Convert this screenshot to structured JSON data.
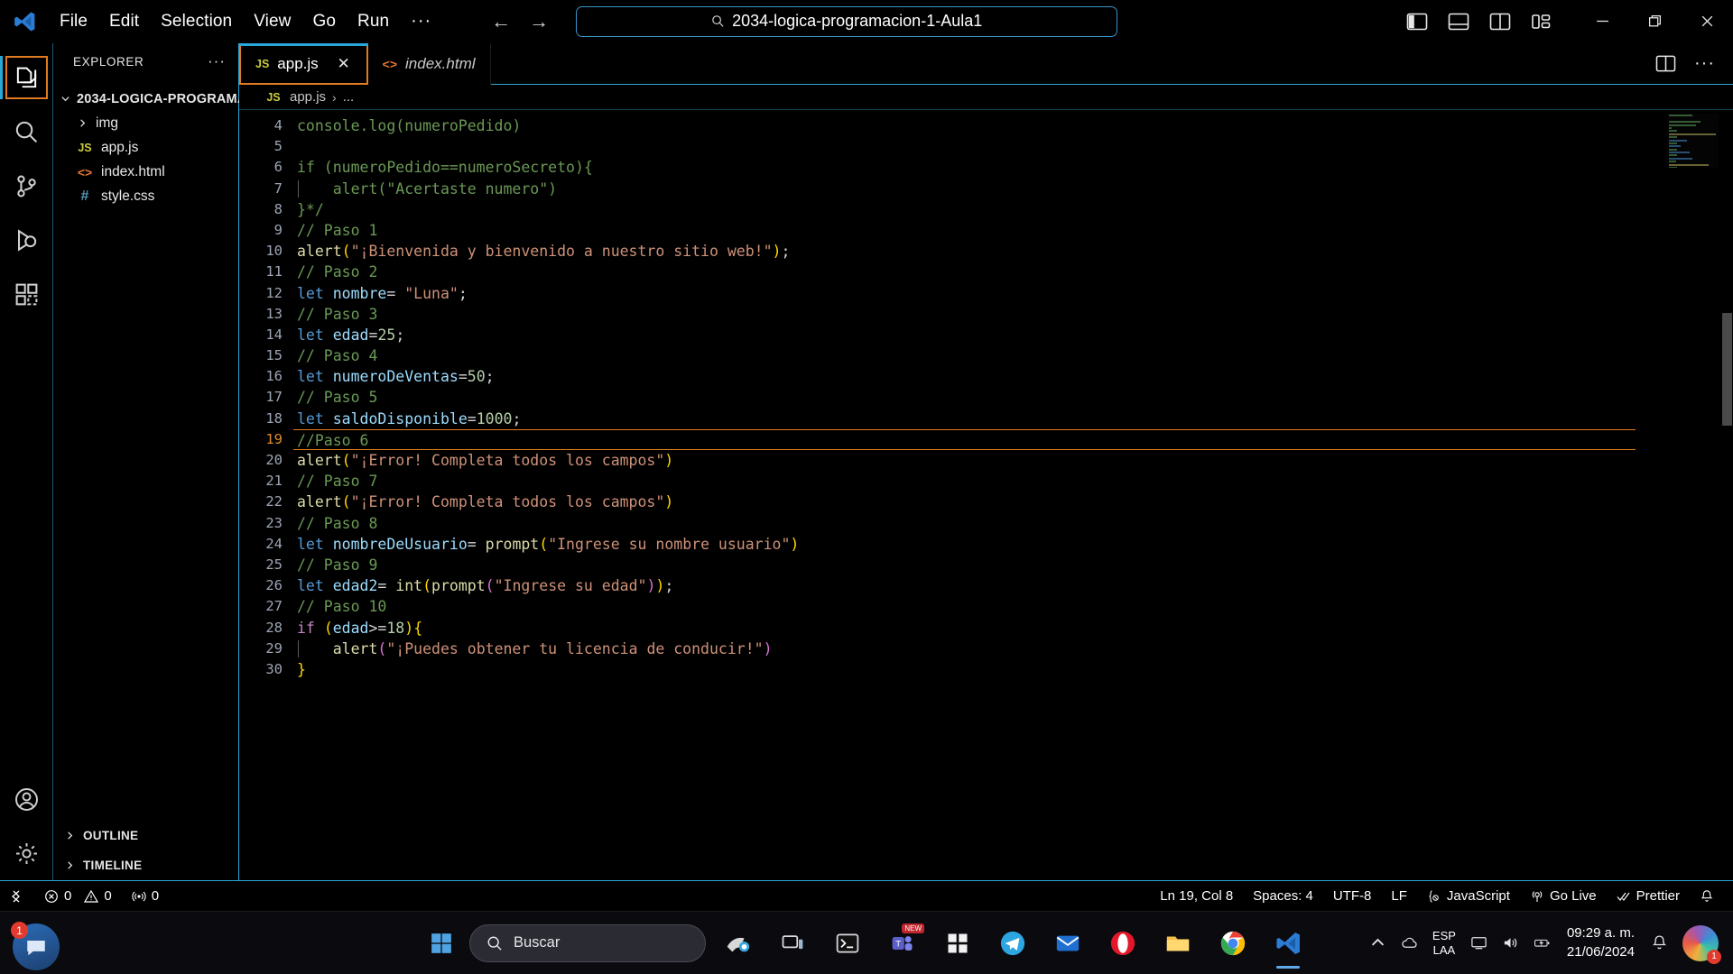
{
  "titlebar": {
    "logo_icon": "vscode-logo-icon",
    "menu": [
      "File",
      "Edit",
      "Selection",
      "View",
      "Go",
      "Run"
    ],
    "menu_overflow": "···",
    "nav_back_icon": "arrow-left-icon",
    "nav_forward_icon": "arrow-right-icon",
    "command_center": {
      "search_icon": "search-icon",
      "value": "2034-logica-programacion-1-Aula1"
    },
    "layout_icons": [
      "toggle-primary-sidebar-icon",
      "toggle-panel-icon",
      "toggle-secondary-sidebar-icon",
      "customize-layout-icon"
    ],
    "window_controls": [
      "minimize-icon",
      "restore-icon",
      "close-icon"
    ]
  },
  "activitybar": {
    "items": [
      {
        "name": "explorer",
        "icon": "files-icon",
        "active": true,
        "focused": true
      },
      {
        "name": "search",
        "icon": "search-icon",
        "active": false
      },
      {
        "name": "source-control",
        "icon": "source-control-icon",
        "active": false
      },
      {
        "name": "run-and-debug",
        "icon": "run-debug-icon",
        "active": false
      },
      {
        "name": "extensions",
        "icon": "extensions-icon",
        "active": false
      }
    ],
    "bottom": [
      {
        "name": "accounts",
        "icon": "account-icon",
        "badge": ""
      },
      {
        "name": "manage",
        "icon": "gear-icon",
        "badge": ""
      }
    ]
  },
  "sidebar": {
    "title": "EXPLORER",
    "more_actions": "···",
    "root": {
      "label": "2034-LOGICA-PROGRAMA...",
      "expanded": true
    },
    "files": [
      {
        "label": "img",
        "icon": "folder-icon",
        "kind": "folder",
        "expanded": false
      },
      {
        "label": "app.js",
        "icon": "js-file-icon",
        "kind": "js",
        "badge": "JS"
      },
      {
        "label": "index.html",
        "icon": "html-file-icon",
        "kind": "html",
        "badge": "<>"
      },
      {
        "label": "style.css",
        "icon": "css-file-icon",
        "kind": "css",
        "badge": "#"
      }
    ],
    "sections": [
      {
        "label": "OUTLINE",
        "expanded": false
      },
      {
        "label": "TIMELINE",
        "expanded": false
      }
    ]
  },
  "editor": {
    "tabs": [
      {
        "label": "app.js",
        "badge": "JS",
        "kind": "js",
        "active": true,
        "preview": false,
        "close_icon": "close-icon"
      },
      {
        "label": "index.html",
        "badge": "<>",
        "kind": "html",
        "active": false,
        "preview": true
      }
    ],
    "actions": [
      "split-editor-icon",
      "more-actions-icon"
    ],
    "breadcrumb": {
      "badge": "JS",
      "file": "app.js",
      "separator": "›",
      "symbol": "..."
    },
    "first_visible_line": 4,
    "code_lines": [
      {
        "n": 4,
        "active": false,
        "tokens": [
          {
            "t": "com",
            "v": "console.log(numeroPedido)"
          }
        ]
      },
      {
        "n": 5,
        "active": false,
        "tokens": []
      },
      {
        "n": 6,
        "active": false,
        "tokens": [
          {
            "t": "com",
            "v": "if (numeroPedido==numeroSecreto){"
          }
        ]
      },
      {
        "n": 7,
        "active": false,
        "guide": true,
        "tokens": [
          {
            "t": "com",
            "v": "    alert(\"Acertaste numero\")"
          }
        ]
      },
      {
        "n": 8,
        "active": false,
        "tokens": [
          {
            "t": "com",
            "v": "}*/"
          }
        ]
      },
      {
        "n": 9,
        "active": false,
        "tokens": [
          {
            "t": "com",
            "v": "// Paso 1"
          }
        ]
      },
      {
        "n": 10,
        "active": false,
        "tokens": [
          {
            "t": "fn",
            "v": "alert"
          },
          {
            "t": "p1",
            "v": "("
          },
          {
            "t": "str",
            "v": "\"¡Bienvenida y bienvenido a nuestro sitio web!\""
          },
          {
            "t": "p1",
            "v": ")"
          },
          {
            "t": "pun",
            "v": ";"
          }
        ]
      },
      {
        "n": 11,
        "active": false,
        "tokens": [
          {
            "t": "com",
            "v": "// Paso 2"
          }
        ]
      },
      {
        "n": 12,
        "active": false,
        "tokens": [
          {
            "t": "kw",
            "v": "let"
          },
          {
            "t": "pun",
            "v": " "
          },
          {
            "t": "var",
            "v": "nombre"
          },
          {
            "t": "op",
            "v": "= "
          },
          {
            "t": "str",
            "v": "\"Luna\""
          },
          {
            "t": "pun",
            "v": ";"
          }
        ]
      },
      {
        "n": 13,
        "active": false,
        "tokens": [
          {
            "t": "com",
            "v": "// Paso 3"
          }
        ]
      },
      {
        "n": 14,
        "active": false,
        "tokens": [
          {
            "t": "kw",
            "v": "let"
          },
          {
            "t": "pun",
            "v": " "
          },
          {
            "t": "var",
            "v": "edad"
          },
          {
            "t": "op",
            "v": "="
          },
          {
            "t": "num",
            "v": "25"
          },
          {
            "t": "pun",
            "v": ";"
          }
        ]
      },
      {
        "n": 15,
        "active": false,
        "tokens": [
          {
            "t": "com",
            "v": "// Paso 4"
          }
        ]
      },
      {
        "n": 16,
        "active": false,
        "tokens": [
          {
            "t": "kw",
            "v": "let"
          },
          {
            "t": "pun",
            "v": " "
          },
          {
            "t": "var",
            "v": "numeroDeVentas"
          },
          {
            "t": "op",
            "v": "="
          },
          {
            "t": "num",
            "v": "50"
          },
          {
            "t": "pun",
            "v": ";"
          }
        ]
      },
      {
        "n": 17,
        "active": false,
        "tokens": [
          {
            "t": "com",
            "v": "// Paso 5"
          }
        ]
      },
      {
        "n": 18,
        "active": false,
        "tokens": [
          {
            "t": "kw",
            "v": "let"
          },
          {
            "t": "pun",
            "v": " "
          },
          {
            "t": "var",
            "v": "saldoDisponible"
          },
          {
            "t": "op",
            "v": "="
          },
          {
            "t": "num",
            "v": "1000"
          },
          {
            "t": "pun",
            "v": ";"
          }
        ]
      },
      {
        "n": 19,
        "active": true,
        "tokens": [
          {
            "t": "com",
            "v": "//Paso 6"
          }
        ]
      },
      {
        "n": 20,
        "active": false,
        "tokens": [
          {
            "t": "fn",
            "v": "alert"
          },
          {
            "t": "p1",
            "v": "("
          },
          {
            "t": "str",
            "v": "\"¡Error! Completa todos los campos\""
          },
          {
            "t": "p1",
            "v": ")"
          }
        ]
      },
      {
        "n": 21,
        "active": false,
        "tokens": [
          {
            "t": "com",
            "v": "// Paso 7"
          }
        ]
      },
      {
        "n": 22,
        "active": false,
        "tokens": [
          {
            "t": "fn",
            "v": "alert"
          },
          {
            "t": "p1",
            "v": "("
          },
          {
            "t": "str",
            "v": "\"¡Error! Completa todos los campos\""
          },
          {
            "t": "p1",
            "v": ")"
          }
        ]
      },
      {
        "n": 23,
        "active": false,
        "tokens": [
          {
            "t": "com",
            "v": "// Paso 8"
          }
        ]
      },
      {
        "n": 24,
        "active": false,
        "tokens": [
          {
            "t": "kw",
            "v": "let"
          },
          {
            "t": "pun",
            "v": " "
          },
          {
            "t": "var",
            "v": "nombreDeUsuario"
          },
          {
            "t": "op",
            "v": "= "
          },
          {
            "t": "fn",
            "v": "prompt"
          },
          {
            "t": "p1",
            "v": "("
          },
          {
            "t": "str",
            "v": "\"Ingrese su nombre usuario\""
          },
          {
            "t": "p1",
            "v": ")"
          }
        ]
      },
      {
        "n": 25,
        "active": false,
        "tokens": [
          {
            "t": "com",
            "v": "// Paso 9"
          }
        ]
      },
      {
        "n": 26,
        "active": false,
        "tokens": [
          {
            "t": "kw",
            "v": "let"
          },
          {
            "t": "pun",
            "v": " "
          },
          {
            "t": "var",
            "v": "edad2"
          },
          {
            "t": "op",
            "v": "= "
          },
          {
            "t": "fn",
            "v": "int"
          },
          {
            "t": "p1",
            "v": "("
          },
          {
            "t": "fn",
            "v": "prompt"
          },
          {
            "t": "p2",
            "v": "("
          },
          {
            "t": "str",
            "v": "\"Ingrese su edad\""
          },
          {
            "t": "p2",
            "v": ")"
          },
          {
            "t": "p1",
            "v": ")"
          },
          {
            "t": "pun",
            "v": ";"
          }
        ]
      },
      {
        "n": 27,
        "active": false,
        "tokens": [
          {
            "t": "com",
            "v": "// Paso 10"
          }
        ]
      },
      {
        "n": 28,
        "active": false,
        "tokens": [
          {
            "t": "ctl",
            "v": "if"
          },
          {
            "t": "pun",
            "v": " "
          },
          {
            "t": "p1",
            "v": "("
          },
          {
            "t": "var",
            "v": "edad"
          },
          {
            "t": "op",
            "v": ">="
          },
          {
            "t": "num",
            "v": "18"
          },
          {
            "t": "p1",
            "v": ")"
          },
          {
            "t": "p1",
            "v": "{"
          }
        ]
      },
      {
        "n": 29,
        "active": false,
        "guide": true,
        "tokens": [
          {
            "t": "pun",
            "v": "    "
          },
          {
            "t": "fn",
            "v": "alert"
          },
          {
            "t": "p2",
            "v": "("
          },
          {
            "t": "str",
            "v": "\"¡Puedes obtener tu licencia de conducir!\""
          },
          {
            "t": "p2",
            "v": ")"
          }
        ]
      },
      {
        "n": 30,
        "active": false,
        "tokens": [
          {
            "t": "p1",
            "v": "}"
          }
        ]
      }
    ]
  },
  "statusbar": {
    "remote_icon": "remote-window-icon",
    "errors": {
      "icon": "error-icon",
      "count": "0"
    },
    "warnings": {
      "icon": "warning-icon",
      "count": "0"
    },
    "ports": {
      "icon": "ports-icon",
      "count": "0"
    },
    "cursor_position": "Ln 19, Col 8",
    "indentation": "Spaces: 4",
    "encoding": "UTF-8",
    "eol": "LF",
    "language": "JavaScript",
    "language_icon": "js-braces-icon",
    "go_live": "Go Live",
    "go_live_icon": "broadcast-icon",
    "prettier": "Prettier",
    "prettier_icon": "checkmarks-icon",
    "notifications_icon": "bell-icon"
  },
  "taskbar": {
    "chat_badge": "1",
    "start_icon": "windows-start-icon",
    "search_icon": "search-icon",
    "search_placeholder": "Buscar",
    "apps": [
      {
        "name": "paint-app",
        "icon": "paint-icon"
      },
      {
        "name": "task-view",
        "icon": "task-view-icon"
      },
      {
        "name": "terminal-app",
        "icon": "terminal-icon"
      },
      {
        "name": "teams-app",
        "icon": "teams-icon",
        "badge": "NEW"
      },
      {
        "name": "store-app",
        "icon": "microsoft-store-icon"
      },
      {
        "name": "telegram-app",
        "icon": "telegram-icon"
      },
      {
        "name": "mail-app",
        "icon": "mail-icon"
      },
      {
        "name": "opera-app",
        "icon": "opera-icon"
      },
      {
        "name": "file-explorer-app",
        "icon": "folder-icon"
      },
      {
        "name": "chrome-app",
        "icon": "chrome-icon"
      },
      {
        "name": "vscode-app",
        "icon": "vscode-icon",
        "active": true
      }
    ],
    "tray": {
      "chevron_icon": "chevron-up-icon",
      "onedrive_icon": "cloud-icon",
      "display_icon": "display-icon",
      "volume_icon": "volume-icon",
      "battery_icon": "battery-icon",
      "language": "ESP",
      "layout": "LAA",
      "time": "09:29 a. m.",
      "date": "21/06/2024",
      "notification_icon": "bell-icon",
      "copilot_badge": "1"
    }
  },
  "colors": {
    "accent_blue": "#2aa7d8",
    "focus_orange": "#e07b1f",
    "comment_green": "#6A9955",
    "string_salmon": "#CE9178",
    "keyword_blue": "#569CD6",
    "variable_lightblue": "#9CDCFE",
    "function_yellow": "#DCDCAA",
    "number_green": "#B5CEA8",
    "control_purple": "#C586C0"
  }
}
